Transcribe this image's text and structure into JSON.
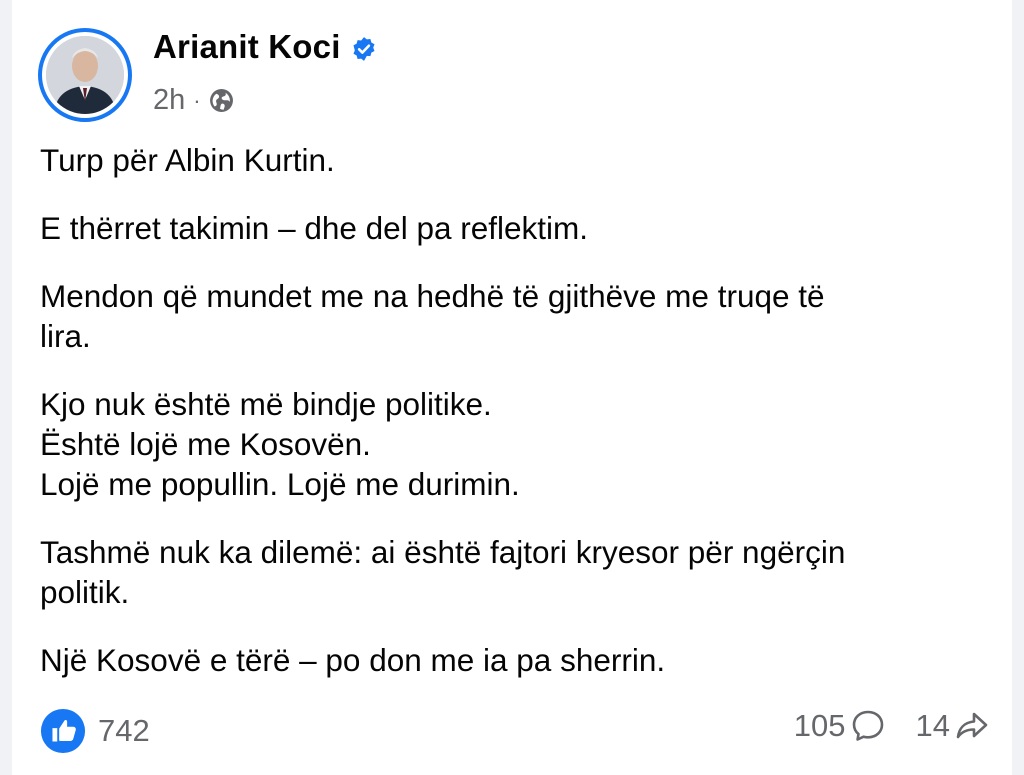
{
  "post": {
    "author": "Arianit Koci",
    "time": "2h",
    "separator": "·",
    "privacy_icon": "globe-icon",
    "verified_icon": "verified-badge-icon",
    "paragraphs": [
      [
        "Turp për Albin Kurtin."
      ],
      [
        "E thërret takimin – dhe del pa reflektim."
      ],
      [
        "Mendon që mundet me na hedhë të gjithëve me truqe të",
        "lira."
      ],
      [
        "Kjo nuk është më bindje politike.",
        "Është lojë me Kosovën.",
        "Lojë me popullin. Lojë me durimin."
      ],
      [
        "Tashmë nuk ka dilemë: ai është fajtori kryesor për ngërçin",
        "politik."
      ],
      [
        "Një Kosovë e tërë – po don me ia pa sherrin."
      ]
    ]
  },
  "stats": {
    "reactions": "742",
    "comments": "105",
    "shares": "14",
    "reaction_icon": "like-icon",
    "comment_icon": "comment-icon",
    "share_icon": "share-icon"
  },
  "colors": {
    "accent": "#1877f2",
    "secondary_text": "#65676b",
    "background": "#f0f2f5"
  }
}
